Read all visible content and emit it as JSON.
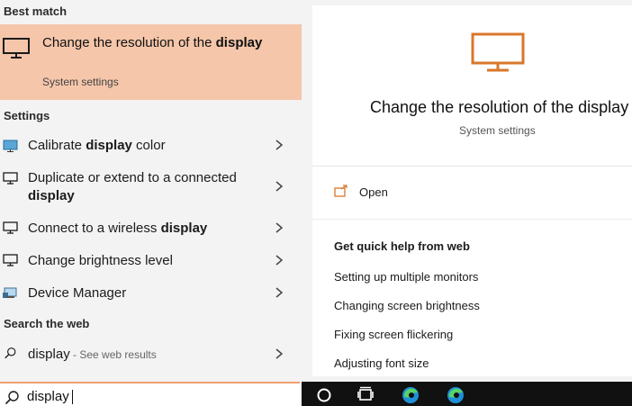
{
  "left": {
    "best_match_label": "Best match",
    "best_match": {
      "title": "Change the resolution of the ",
      "title_bold": "display",
      "subtitle": "System settings",
      "icon": "monitor-icon"
    },
    "settings_label": "Settings",
    "settings_items": [
      {
        "pre": "Calibrate ",
        "bold": "display",
        "post": " color",
        "icon": "calibrate-display-icon"
      },
      {
        "pre": "Duplicate or extend to a connected ",
        "bold": "display",
        "post": "",
        "icon": "monitor-icon"
      },
      {
        "pre": "Connect to a wireless ",
        "bold": "display",
        "post": "",
        "icon": "monitor-icon"
      },
      {
        "pre": "Change brightness level",
        "bold": "",
        "post": "",
        "icon": "monitor-icon"
      },
      {
        "pre": "Device Manager",
        "bold": "",
        "post": "",
        "icon": "device-manager-icon"
      }
    ],
    "web_label": "Search the web",
    "web_item": {
      "query": "display",
      "hint": " - See web results",
      "icon": "search-icon"
    }
  },
  "search": {
    "value": "display",
    "icon": "search-icon"
  },
  "right": {
    "title": "Change the resolution of the display",
    "subtitle": "System settings",
    "open_label": "Open",
    "quick_help_title": "Get quick help from web",
    "quick_help_links": [
      "Setting up multiple monitors",
      "Changing screen brightness",
      "Fixing screen flickering",
      "Adjusting font size"
    ]
  },
  "colors": {
    "accent": "#d9772b",
    "highlight": "#f5c6aa",
    "taskbar": "#111111"
  }
}
